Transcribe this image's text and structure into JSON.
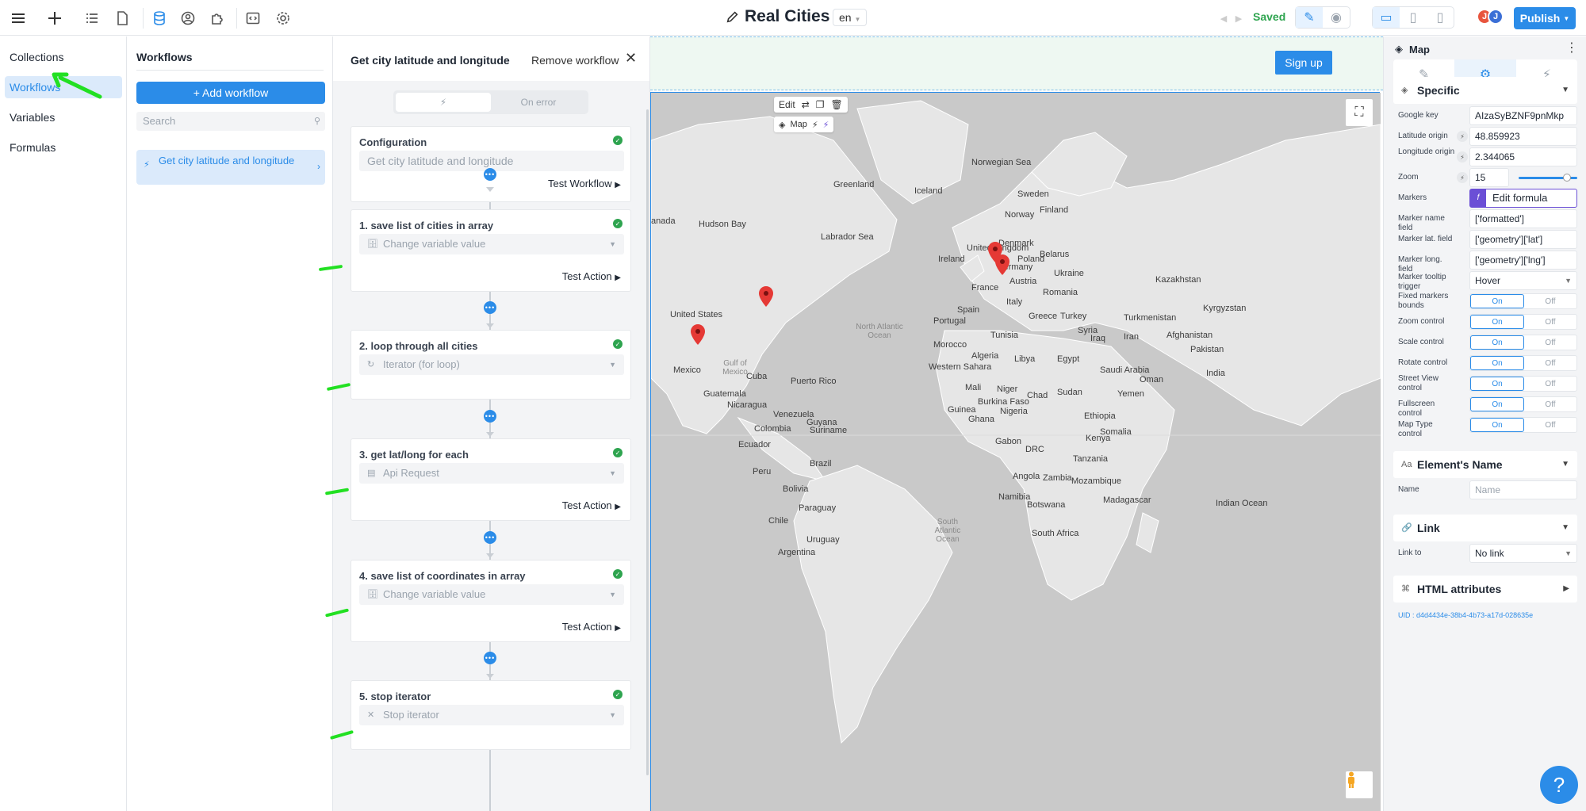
{
  "app": {
    "title": "Real Cities",
    "lang": "en",
    "status": "Saved",
    "publish_label": "Publish",
    "avatars": [
      "J",
      "J"
    ]
  },
  "leftnav": {
    "items": [
      {
        "label": "Collections"
      },
      {
        "label": "Workflows",
        "active": true
      },
      {
        "label": "Variables"
      },
      {
        "label": "Formulas"
      }
    ]
  },
  "workflows": {
    "title": "Workflows",
    "add_label": "+ Add workflow",
    "search_placeholder": "Search",
    "items": [
      {
        "label": "Get city latitude and longitude"
      }
    ]
  },
  "editor": {
    "title": "Get city latitude and longitude",
    "remove_label": "Remove workflow",
    "tab_on_error": "On error",
    "config": {
      "title": "Configuration",
      "value": "Get city latitude and longitude",
      "test_label": "Test Workflow"
    },
    "steps": [
      {
        "title": "1. save list of cities in array",
        "field": "Change variable value",
        "test_label": "Test Action"
      },
      {
        "title": "2. loop through all cities",
        "field": "Iterator (for loop)",
        "test_label": ""
      },
      {
        "title": "3. get lat/long for each",
        "field": "Api Request",
        "test_label": "Test Action"
      },
      {
        "title": "4. save list of coordinates in array",
        "field": "Change variable value",
        "test_label": "Test Action"
      },
      {
        "title": "5. stop iterator",
        "field": "Stop iterator",
        "test_label": ""
      }
    ]
  },
  "canvas": {
    "signup_label": "Sign up",
    "edit_label": "Edit",
    "map_badge": "Map",
    "map_labels": {
      "greenland": "Greenland",
      "iceland": "Iceland",
      "norwegian_sea": "Norwegian Sea",
      "sweden": "Sweden",
      "finland": "Finland",
      "norway": "Norway",
      "hudson_bay": "Hudson Bay",
      "labrador_sea": "Labrador Sea",
      "canada": "anada",
      "ireland": "Ireland",
      "uk": "United Kingdom",
      "denmark": "Denmark",
      "poland": "Poland",
      "belarus": "Belarus",
      "germany": "Germany",
      "ukraine": "Ukraine",
      "kazakhstan": "Kazakhstan",
      "france": "France",
      "austria": "Austria",
      "romania": "Romania",
      "italy": "Italy",
      "spain": "Spain",
      "portugal": "Portugal",
      "greece": "Greece",
      "turkey": "Turkey",
      "turkmenistan": "Turkmenistan",
      "kyrgyzstan": "Kyrgyzstan",
      "united_states": "United States",
      "north_atlantic": "North Atlantic Ocean",
      "morocco": "Morocco",
      "tunisia": "Tunisia",
      "syria": "Syria",
      "iraq": "Iraq",
      "iran": "Iran",
      "afghanistan": "Afghanistan",
      "pakistan": "Pakistan",
      "mexico": "Mexico",
      "gulf_mexico": "Gulf of Mexico",
      "cuba": "Cuba",
      "puerto_rico": "Puerto Rico",
      "algeria": "Algeria",
      "libya": "Libya",
      "egypt": "Egypt",
      "saudi": "Saudi Arabia",
      "oman": "Oman",
      "india": "India",
      "western_sahara": "Western Sahara",
      "guatemala": "Guatemala",
      "nicaragua": "Nicaragua",
      "mali": "Mali",
      "niger": "Niger",
      "chad": "Chad",
      "sudan": "Sudan",
      "yemen": "Yemen",
      "venezuela": "Venezuela",
      "guyana": "Guyana",
      "suriname": "Suriname",
      "colombia": "Colombia",
      "guinea": "Guinea",
      "burkina": "Burkina Faso",
      "ghana": "Ghana",
      "nigeria": "Nigeria",
      "ethiopia": "Ethiopia",
      "somalia": "Somalia",
      "ecuador": "Ecuador",
      "gabon": "Gabon",
      "kenya": "Kenya",
      "peru": "Peru",
      "brazil": "Brazil",
      "drc": "DRC",
      "tanzania": "Tanzania",
      "bolivia": "Bolivia",
      "angola": "Angola",
      "zambia": "Zambia",
      "mozambique": "Mozambique",
      "namibia": "Namibia",
      "botswana": "Botswana",
      "madagascar": "Madagascar",
      "paraguay": "Paraguay",
      "chile": "Chile",
      "uruguay": "Uruguay",
      "south_africa": "South Africa",
      "south_atlantic": "South Atlantic Ocean",
      "argentina": "Argentina",
      "indian_ocean": "Indian Ocean"
    }
  },
  "props": {
    "header": "Map",
    "specific": "Specific",
    "google_key_label": "Google key",
    "google_key": "AIzaSyBZNF9pnMkp",
    "lat_label": "Latitude origin",
    "lat": "48.859923",
    "lng_label": "Longitude origin",
    "lng": "2.344065",
    "zoom_label": "Zoom",
    "zoom": "15",
    "zoom_level": 0.82,
    "markers_label": "Markers",
    "markers_value": "Edit formula",
    "name_field_label": "Marker name field",
    "name_field": "['formatted']",
    "lat_field_label": "Marker lat. field",
    "lat_field": "['geometry']['lat']",
    "lng_field_label": "Marker long. field",
    "lng_field": "['geometry']['lng']",
    "tooltip_label": "Marker tooltip trigger",
    "tooltip": "Hover",
    "on": "On",
    "off": "Off",
    "toggles": [
      "Fixed markers bounds",
      "Zoom control",
      "Scale control",
      "Rotate control",
      "Street View control",
      "Fullscreen control",
      "Map Type control"
    ],
    "element_name": "Element's Name",
    "name_label": "Name",
    "name_placeholder": "Name",
    "link": "Link",
    "link_to_label": "Link to",
    "link_to": "No link",
    "html_attrs": "HTML attributes",
    "uid": "UID : d4d4434e-38b4-4b73-a17d-028635e"
  },
  "help_label": "?"
}
